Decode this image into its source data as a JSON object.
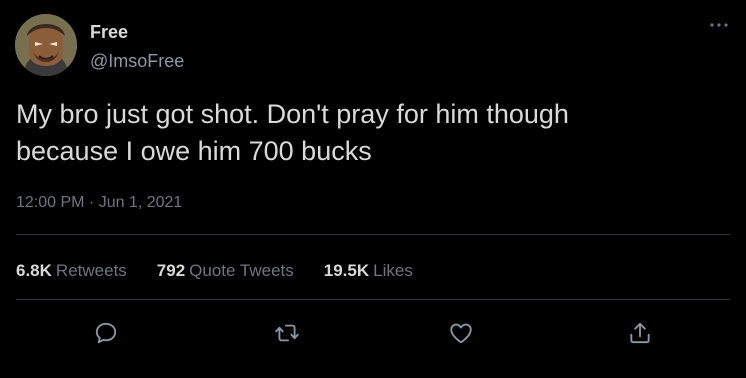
{
  "user": {
    "display_name": "Free",
    "handle": "@ImsoFree"
  },
  "tweet": {
    "text": "My bro just got shot. Don't pray for him though\nbecause I owe him 700 bucks",
    "timestamp": "12:00 PM · Jun 1, 2021"
  },
  "stats": {
    "retweets": {
      "count": "6.8K",
      "label": "Retweets"
    },
    "quote_tweets": {
      "count": "792",
      "label": "Quote Tweets"
    },
    "likes": {
      "count": "19.5K",
      "label": "Likes"
    }
  },
  "icons": {
    "more": "more-horizontal-icon",
    "reply": "reply-icon",
    "retweet": "retweet-icon",
    "like": "heart-icon",
    "share": "share-icon"
  },
  "colors": {
    "background": "#000000",
    "primary_text": "#d9d9d9",
    "secondary_text": "#6e767d",
    "divider": "#2f3336"
  }
}
